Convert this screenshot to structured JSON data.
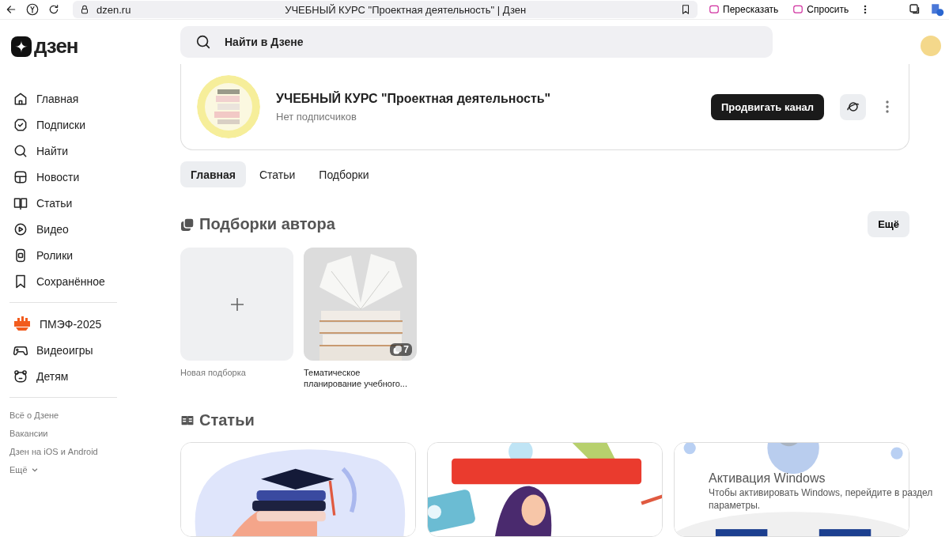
{
  "browser": {
    "address": "dzen.ru",
    "title": "УЧЕБНЫЙ КУРС \"Проектная деятельность\" | Дзен",
    "actions": [
      "Пересказать",
      "Спросить"
    ]
  },
  "logo": "дзен",
  "search": {
    "placeholder": "Найти в Дзене"
  },
  "sidebar": {
    "items": [
      {
        "label": "Главная"
      },
      {
        "label": "Подписки"
      },
      {
        "label": "Найти"
      },
      {
        "label": "Новости"
      },
      {
        "label": "Статьи"
      },
      {
        "label": "Видео"
      },
      {
        "label": "Ролики"
      },
      {
        "label": "Сохранённое"
      }
    ],
    "special": [
      {
        "label": "ПМЭФ-2025"
      },
      {
        "label": "Видеоигры"
      },
      {
        "label": "Детям"
      }
    ],
    "links": [
      "Всё о Дзене",
      "Вакансии",
      "Дзен на iOS и Android"
    ],
    "more": "Ещё"
  },
  "channel": {
    "name": "УЧЕБНЫЙ КУРС \"Проектная деятельность\"",
    "subscribers": "Нет подписчиков",
    "promote_button": "Продвигать канал"
  },
  "tabs": [
    {
      "label": "Главная",
      "selected": true
    },
    {
      "label": "Статьи",
      "selected": false
    },
    {
      "label": "Подборки",
      "selected": false
    }
  ],
  "collections": {
    "title": "Подборки автора",
    "more_button": "Ещё",
    "items": [
      {
        "kind": "new",
        "label": "Новая подборка"
      },
      {
        "kind": "collection",
        "label": "Тематическое планирование учебного...",
        "count": "7"
      }
    ]
  },
  "articles": {
    "title": "Статьи"
  },
  "os_notice": {
    "title": "Активация Windows",
    "text": "Чтобы активировать Windows, перейдите в раздел",
    "text_2": "параметры."
  }
}
